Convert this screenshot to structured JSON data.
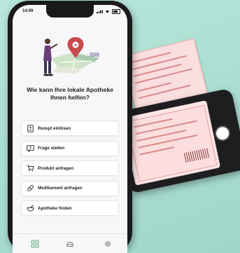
{
  "status_bar": {
    "time": "14:09"
  },
  "app": {
    "headline_line1": "Wie kann Ihre lokale Apotheke",
    "headline_line2": "Ihnen helfen?",
    "menu": [
      {
        "label": "Rezept einlösen",
        "icon": "prescription-icon"
      },
      {
        "label": "Frage stellen",
        "icon": "question-icon"
      },
      {
        "label": "Produkt anfragen",
        "icon": "cart-icon"
      },
      {
        "label": "Medikament anfragen",
        "icon": "pill-icon"
      },
      {
        "label": "Apotheke finden",
        "icon": "mortar-icon"
      }
    ],
    "tabbar": [
      "home-grid-icon",
      "car-icon",
      "settings-icon"
    ]
  },
  "colors": {
    "accent": "#c9494f",
    "background": "#a9ddd0",
    "rx_pink": "#fbdede"
  }
}
